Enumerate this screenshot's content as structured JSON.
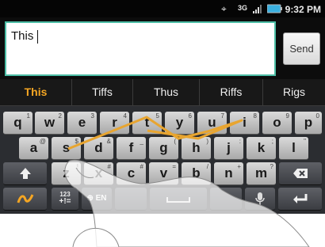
{
  "status_bar": {
    "icons": [
      "gps-icon",
      "network-3g-icon",
      "signal-icon",
      "battery-icon"
    ],
    "network_label": "3G",
    "time": "9:32 PM"
  },
  "compose": {
    "message_text": "This",
    "send_label": "Send"
  },
  "suggestions": [
    "This",
    "Tiffs",
    "Thus",
    "Riffs",
    "Rigs"
  ],
  "keyboard": {
    "row1": [
      {
        "label": "q",
        "sub": "1"
      },
      {
        "label": "w",
        "sub": "2"
      },
      {
        "label": "e",
        "sub": "3"
      },
      {
        "label": "r",
        "sub": "4"
      },
      {
        "label": "t",
        "sub": "5"
      },
      {
        "label": "y",
        "sub": "6"
      },
      {
        "label": "u",
        "sub": "7"
      },
      {
        "label": "i",
        "sub": "8"
      },
      {
        "label": "o",
        "sub": "9"
      },
      {
        "label": "p",
        "sub": "0"
      }
    ],
    "row2": [
      {
        "label": "a",
        "sub": "@"
      },
      {
        "label": "s",
        "sub": "$"
      },
      {
        "label": "d",
        "sub": "&"
      },
      {
        "label": "f",
        "sub": "_"
      },
      {
        "label": "g",
        "sub": "("
      },
      {
        "label": "h",
        "sub": ")"
      },
      {
        "label": "j",
        "sub": ":"
      },
      {
        "label": "k",
        "sub": ";"
      },
      {
        "label": "l",
        "sub": "\""
      }
    ],
    "row3": [
      {
        "label": "z",
        "sub": "!"
      },
      {
        "label": "x",
        "sub": "#"
      },
      {
        "label": "c",
        "sub": "#"
      },
      {
        "label": "v",
        "sub": "="
      },
      {
        "label": "b",
        "sub": "/"
      },
      {
        "label": "n",
        "sub": "+"
      },
      {
        "label": "m",
        "sub": "?"
      }
    ],
    "shift_icon": "shift-arrow-icon",
    "backspace_icon": "backspace-icon",
    "swype_icon": "swype-logo-icon",
    "sym_top": "123",
    "sym_bottom": "+!=",
    "lang_label": "EN",
    "mic_icon": "microphone-icon",
    "enter_icon": "enter-icon",
    "trace_color": "#e8a530"
  }
}
